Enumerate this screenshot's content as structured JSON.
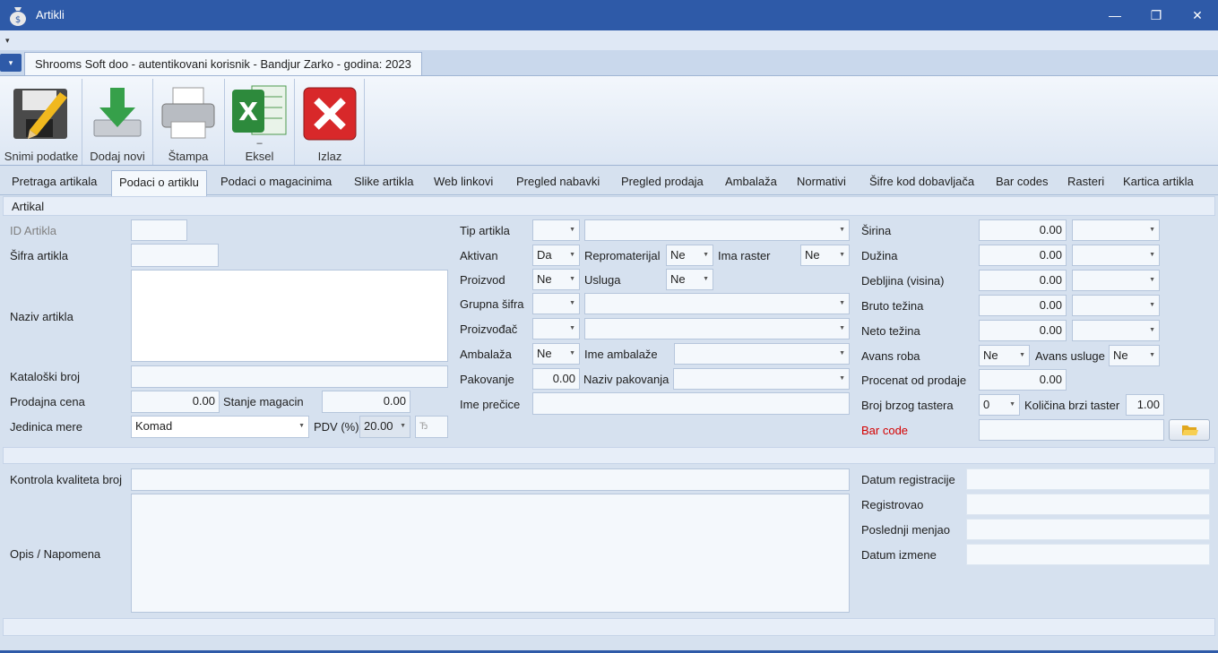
{
  "window": {
    "title": "Artikli",
    "minimize": "—",
    "maximize": "❐",
    "close": "✕"
  },
  "qat": {
    "dropdown": "▾"
  },
  "ribbon": {
    "app_menu": "▾",
    "context_tab": "Shrooms Soft doo - autentikovani korisnik - Bandjur Zarko - godina: 2023",
    "buttons": [
      {
        "label": "Snimi podatke"
      },
      {
        "label": "Dodaj novi"
      },
      {
        "label": "Štampa"
      },
      {
        "label": "Eksel",
        "sub": "–"
      },
      {
        "label": "Izlaz"
      }
    ]
  },
  "tabs": [
    "Pretraga artikala",
    "Podaci o artiklu",
    "Podaci o magacinima",
    "Slike artikla",
    "Web linkovi",
    "Pregled nabavki",
    "Pregled prodaja",
    "Ambalaža",
    "Normativi",
    "Šifre kod dobavljača",
    "Bar codes",
    "Rasteri",
    "Kartica artikla"
  ],
  "active_tab": "Podaci o artiklu",
  "section_title": "Artikal",
  "left": {
    "id_label": "ID Artikla",
    "id_value": "",
    "sifra_label": "Šifra artikla",
    "sifra_value": "",
    "naziv_label": "Naziv artikla",
    "naziv_value": "",
    "katalog_label": "Kataloški broj",
    "katalog_value": "",
    "cena_label": "Prodajna cena",
    "cena_value": "0.00",
    "stanje_label": "Stanje magacin",
    "stanje_value": "0.00",
    "jm_label": "Jedinica mere",
    "jm_value": "Komad",
    "pdv_label": "PDV (%)",
    "pdv_value": "20.00",
    "pdv_symbol": "Ђ"
  },
  "middle": {
    "tip_label": "Tip artikla",
    "tip_value": "",
    "tip_name": "",
    "aktivan_label": "Aktivan",
    "aktivan_value": "Da",
    "repro_label": "Repromaterijal",
    "repro_value": "Ne",
    "raster_label": "Ima raster",
    "raster_value": "Ne",
    "proizvod_label": "Proizvod",
    "proizvod_value": "Ne",
    "usluga_label": "Usluga",
    "usluga_value": "Ne",
    "grupna_label": "Grupna šifra",
    "grupna_value": "",
    "grupna_name": "",
    "proizvodjac_label": "Proizvođač",
    "proizvodjac_value": "",
    "proizvodjac_name": "",
    "ambalaza_label": "Ambalaža",
    "ambalaza_value": "Ne",
    "ime_amb_label": "Ime ambalaže",
    "ime_amb_value": "",
    "pakovanje_label": "Pakovanje",
    "pakovanje_value": "0.00",
    "naziv_pak_label": "Naziv pakovanja",
    "naziv_pak_value": "",
    "precica_label": "Ime prečice",
    "precica_value": ""
  },
  "right": {
    "sirina_label": "Širina",
    "sirina_value": "0.00",
    "duzina_label": "Dužina",
    "duzina_value": "0.00",
    "debljina_label": "Debljina (visina)",
    "debljina_value": "0.00",
    "bruto_label": "Bruto težina",
    "bruto_value": "0.00",
    "neto_label": "Neto težina",
    "neto_value": "0.00",
    "avans_roba_label": "Avans roba",
    "avans_roba_value": "Ne",
    "avans_usl_label": "Avans usluge",
    "avans_usl_value": "Ne",
    "procenat_label": "Procenat od prodaje",
    "procenat_value": "0.00",
    "brzi_label": "Broj brzog tastera",
    "brzi_value": "0",
    "kol_brzi_label": "Količina brzi taster",
    "kol_brzi_value": "1.00",
    "barcode_label": "Bar code",
    "barcode_value": ""
  },
  "bottom": {
    "kontrola_label": "Kontrola kvaliteta broj",
    "kontrola_value": "",
    "opis_label": "Opis / Napomena",
    "opis_value": "",
    "datum_reg_label": "Datum registracije",
    "datum_reg_value": "",
    "registrovao_label": "Registrovao",
    "registrovao_value": "",
    "poslednji_label": "Poslednji menjao",
    "poslednji_value": "",
    "datum_izm_label": "Datum izmene",
    "datum_izm_value": ""
  },
  "colors": {
    "title_bar": "#2e5aa8",
    "barcode_label": "#d40000"
  }
}
